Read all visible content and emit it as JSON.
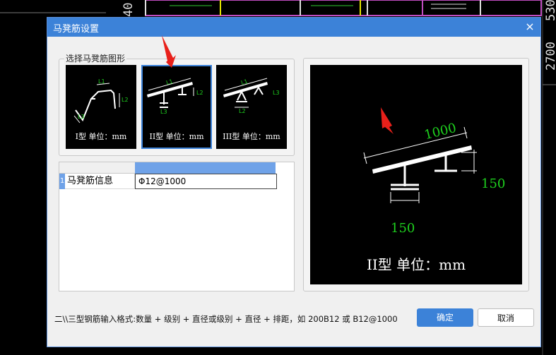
{
  "cad_background": {
    "dim_labels": [
      "40",
      "530",
      "2700"
    ]
  },
  "dialog": {
    "title": "马凳筋设置",
    "close_glyph": "×",
    "shape_group_label": "选择马凳筋图形",
    "shapes": [
      {
        "caption": "I型  单位：mm",
        "dims": [
          "L1",
          "L2",
          "L3"
        ],
        "selected": false
      },
      {
        "caption": "II型  单位：mm",
        "dims": [
          "L1",
          "L2",
          "L3"
        ],
        "selected": true
      },
      {
        "caption": "III型  单位：mm",
        "dims": [
          "L1",
          "L2",
          "L3"
        ],
        "selected": false
      }
    ],
    "grid": {
      "row_number": "1",
      "row_label": "马凳筋信息",
      "row_value": "Φ12@1000"
    },
    "preview": {
      "dim_top": "1000",
      "dim_right": "150",
      "dim_bottom": "150",
      "caption": "II型  单位：mm"
    },
    "hint": "二\\\\三型钢筋输入格式:数量 + 级别 + 直径或级别 + 直径 + 排距，如 200B12 或 B12@1000",
    "ok_label": "确定",
    "cancel_label": "取消"
  },
  "colors": {
    "accent": "#3c82d8",
    "dim_green": "#1ed01e",
    "arrow_red": "#e8201a"
  }
}
